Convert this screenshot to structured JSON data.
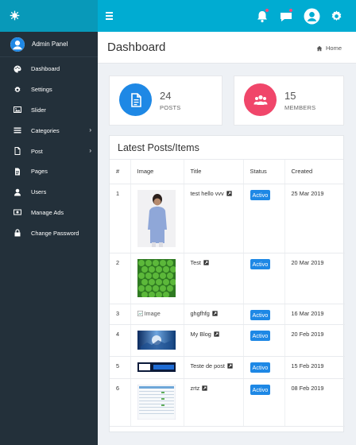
{
  "topbar": {
    "menu_icon": "hamburger-icon",
    "icons": [
      "bell-icon",
      "chat-icon",
      "user-circle-icon",
      "gear-icon"
    ]
  },
  "sidebar": {
    "admin_label": "Admin Panel",
    "items": [
      {
        "label": "Dashboard",
        "icon": "palette-icon"
      },
      {
        "label": "Settings",
        "icon": "gear-icon"
      },
      {
        "label": "Slider",
        "icon": "image-icon"
      },
      {
        "label": "Categories",
        "icon": "list-icon",
        "has_arrow": true
      },
      {
        "label": "Post",
        "icon": "file-icon",
        "has_arrow": true
      },
      {
        "label": "Pages",
        "icon": "file-text-icon"
      },
      {
        "label": "Users",
        "icon": "user-icon"
      },
      {
        "label": "Manage Ads",
        "icon": "money-icon"
      },
      {
        "label": "Change Password",
        "icon": "lock-icon"
      }
    ],
    "arrow": "›"
  },
  "header": {
    "title": "Dashboard",
    "breadcrumb": "Home"
  },
  "stats": [
    {
      "value": "24",
      "label": "POSTS",
      "color": "#1e88e5",
      "icon": "document-icon"
    },
    {
      "value": "15",
      "label": "MEMBERS",
      "color": "#f0466a",
      "icon": "users-icon"
    }
  ],
  "panel": {
    "title": "Latest Posts/Items",
    "columns": [
      "#",
      "Image",
      "Title",
      "Status",
      "Created"
    ],
    "rows": [
      {
        "num": "1",
        "image": "photo-person",
        "title": "test hello vvv",
        "status": "Activo",
        "created": "25 Mar 2019"
      },
      {
        "num": "2",
        "image": "photo-green",
        "title": "Test",
        "status": "Activo",
        "created": "20 Mar 2019"
      },
      {
        "num": "3",
        "image": "broken",
        "image_alt": "Image",
        "title": "ghgfhfg",
        "status": "Activo",
        "created": "16 Mar 2019"
      },
      {
        "num": "4",
        "image": "photo-blue",
        "title": "My Blog",
        "status": "Activo",
        "created": "20 Feb 2019"
      },
      {
        "num": "5",
        "image": "photo-banner",
        "title": "Teste de post",
        "status": "Activo",
        "created": "15 Feb 2019"
      },
      {
        "num": "6",
        "image": "photo-table",
        "title": "zrtz",
        "status": "Activo",
        "created": "08 Feb 2019"
      }
    ]
  }
}
